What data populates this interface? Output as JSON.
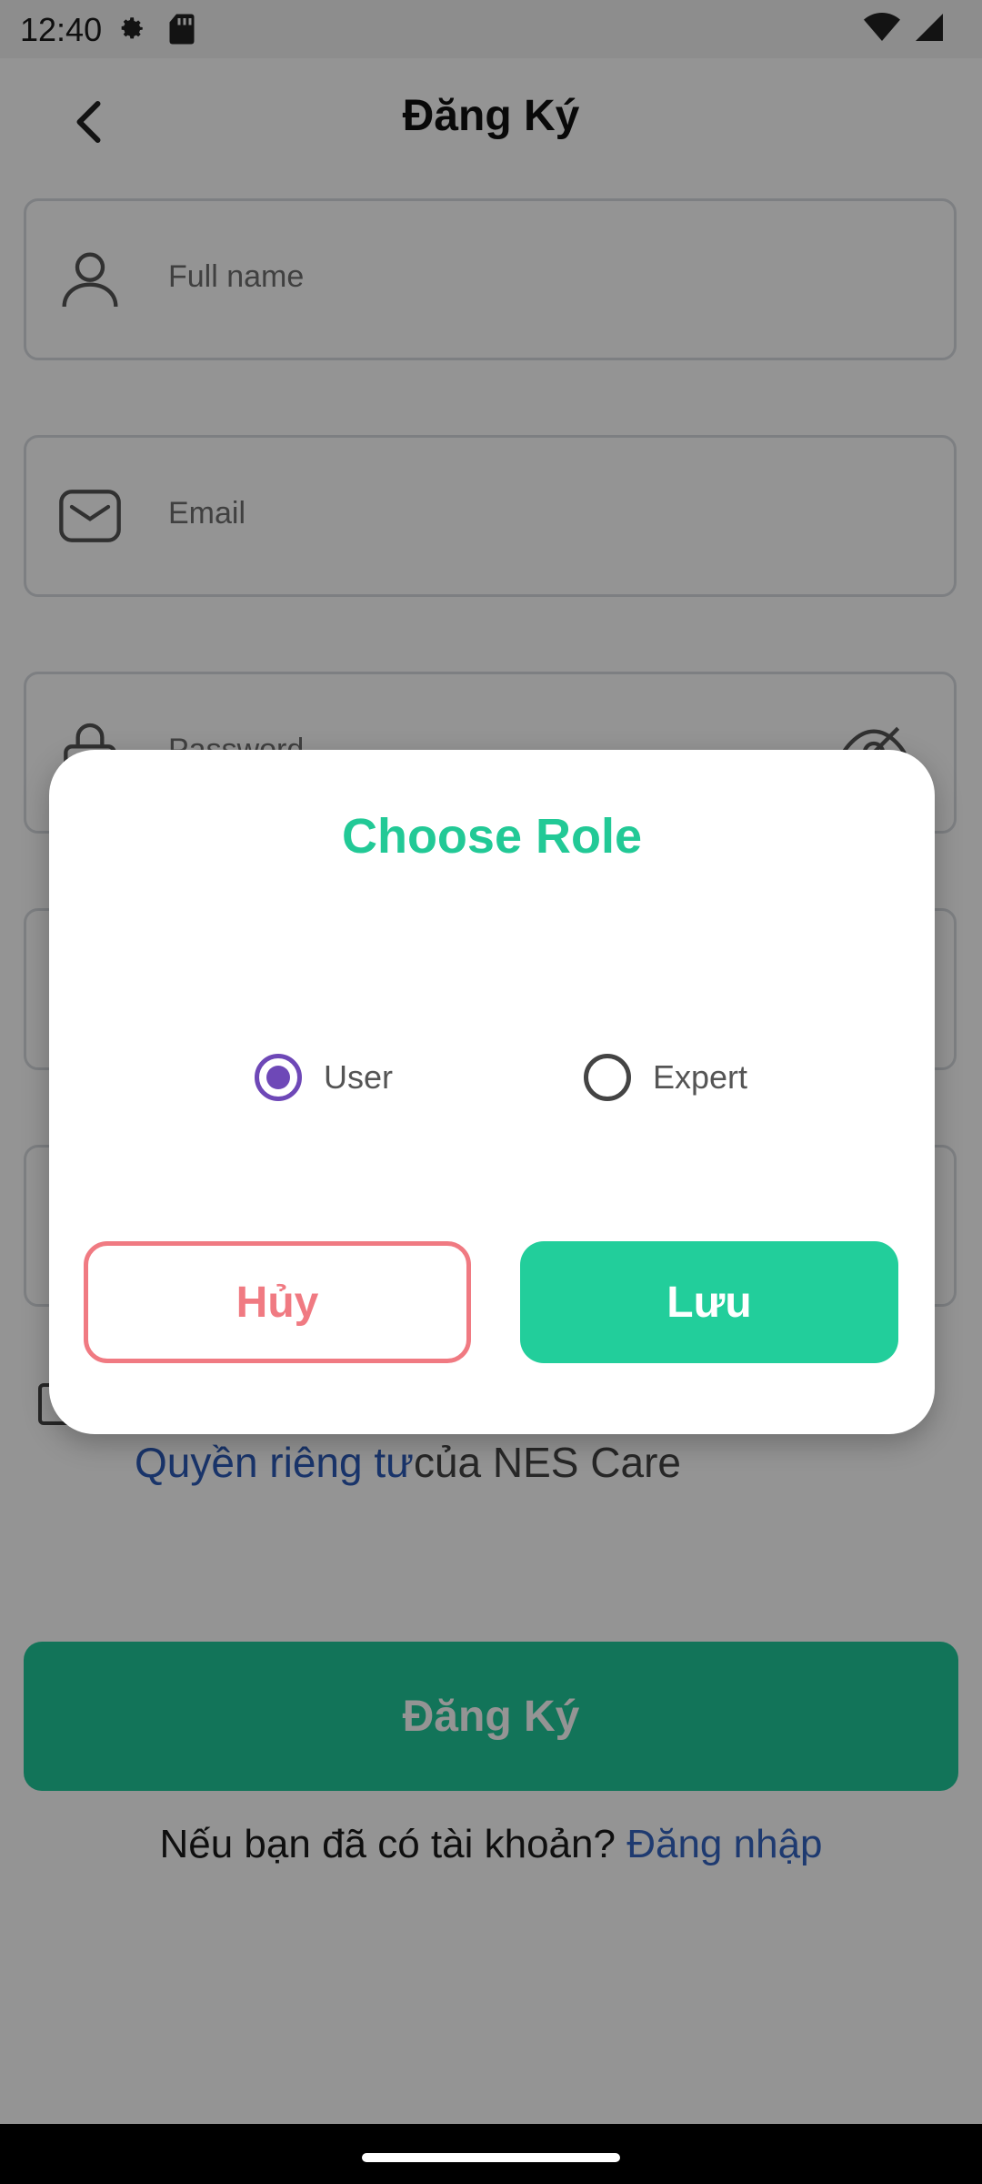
{
  "status_bar": {
    "time": "12:40",
    "left_icons": [
      "settings-icon",
      "sd-card-icon"
    ],
    "right_icons": [
      "wifi-icon",
      "cellular-signal-icon"
    ]
  },
  "app_bar": {
    "back_icon": "chevron-left-icon",
    "title": "Đăng Ký"
  },
  "form": {
    "full_name": {
      "placeholder": "Full name",
      "icon": "person-icon"
    },
    "email": {
      "placeholder": "Email",
      "icon": "envelope-icon"
    },
    "password": {
      "placeholder": "Password",
      "icon": "lock-icon",
      "toggle_icon": "eye-off-icon"
    },
    "privacy": {
      "link_text": "Quyền riêng tư",
      "suffix": "của NES Care"
    },
    "register_button": "Đăng Ký",
    "signin": {
      "prompt": "Nếu bạn đã có tài khoản?",
      "link": "Đăng nhập"
    }
  },
  "dialog": {
    "title": "Choose Role",
    "options": [
      {
        "label": "User",
        "selected": true
      },
      {
        "label": "Expert",
        "selected": false
      }
    ],
    "cancel_label": "Hủy",
    "save_label": "Lưu"
  },
  "colors": {
    "accent_green": "#22C996",
    "cancel_red": "#F07A82",
    "radio_purple": "#6E48B7",
    "link_blue": "#3465C2"
  }
}
